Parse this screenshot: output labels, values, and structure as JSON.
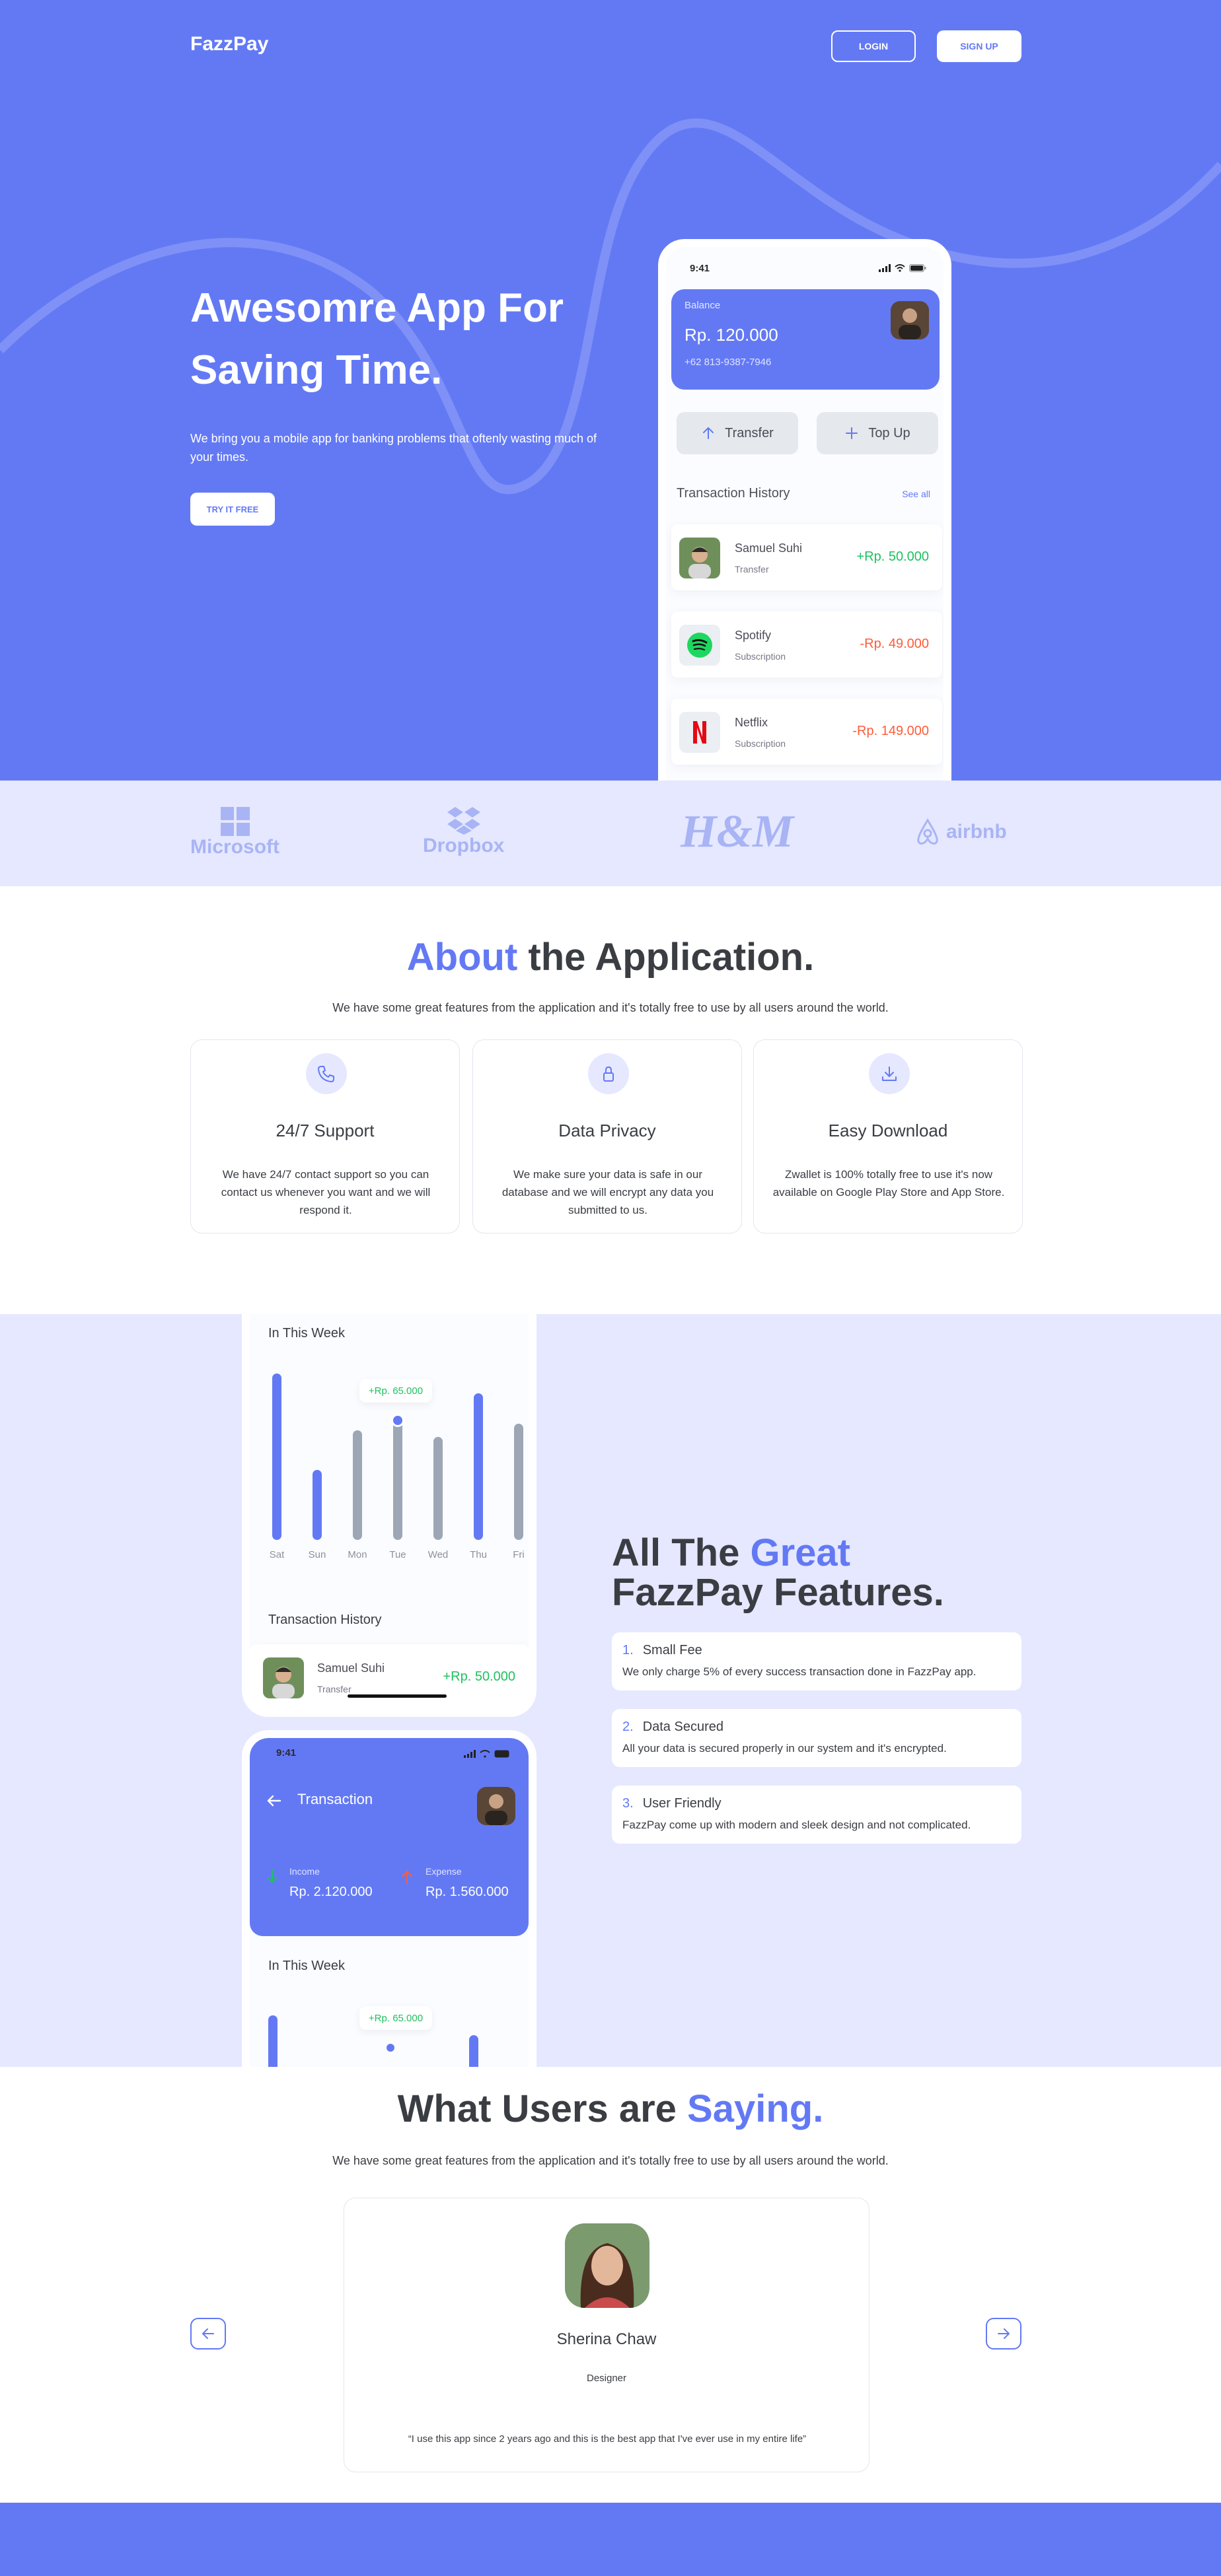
{
  "header": {
    "brand": "FazzPay",
    "login_label": "LOGIN",
    "signup_label": "SIGN UP"
  },
  "hero": {
    "title_line1": "Awesomre App For",
    "title_line2": "Saving Time.",
    "subtitle": "We bring you a mobile app for banking problems that oftenly wasting much of your times.",
    "cta_label": "TRY IT FREE"
  },
  "phone_home": {
    "time": "9:41",
    "balance_label": "Balance",
    "balance_amount": "Rp. 120.000",
    "phone_number": "+62 813-9387-7946",
    "transfer_label": "Transfer",
    "topup_label": "Top Up",
    "history_title": "Transaction History",
    "see_all": "See all",
    "transactions": [
      {
        "name": "Samuel Suhi",
        "type": "Transfer",
        "amount": "+Rp. 50.000"
      },
      {
        "name": "Spotify",
        "type": "Subscription",
        "amount": "-Rp. 49.000"
      },
      {
        "name": "Netflix",
        "type": "Subscription",
        "amount": "-Rp. 149.000"
      }
    ]
  },
  "partners": [
    "Microsoft",
    "Dropbox",
    "H&M",
    "airbnb"
  ],
  "about": {
    "title_accent": "About",
    "title_rest": " the Application.",
    "subtitle": "We have some great features from the application and it's totally free to use by all users around the world.",
    "cards": [
      {
        "title": "24/7 Support",
        "text": "We have 24/7 contact support so you can contact us whenever you want and we will respond it.",
        "icon": "phone-icon"
      },
      {
        "title": "Data Privacy",
        "text": "We make sure your data is safe in our database and we will encrypt any data you submitted to us.",
        "icon": "lock-icon"
      },
      {
        "title": "Easy Download",
        "text": "Zwallet is 100% totally free to use it's now available on Google Play Store and App Store.",
        "icon": "download-icon"
      }
    ]
  },
  "phone_chart": {
    "week_title": "In This Week",
    "tooltip": "+Rp. 65.000",
    "history_title": "Transaction History",
    "tx_name": "Samuel Suhi",
    "tx_type": "Transfer",
    "tx_amount": "+Rp. 50.000"
  },
  "chart_data": {
    "type": "bar",
    "categories": [
      "Sat",
      "Sun",
      "Mon",
      "Tue",
      "Wed",
      "Thu",
      "Fri"
    ],
    "values": [
      100,
      42,
      66,
      72,
      62,
      88,
      70
    ],
    "highlight": [
      true,
      true,
      false,
      false,
      false,
      true,
      false
    ],
    "selected": "Tue",
    "colors": {
      "highlight": "#6379f4",
      "normal": "#9da6b5"
    }
  },
  "phone_trx": {
    "time": "9:41",
    "title": "Transaction",
    "income_label": "Income",
    "income_amount": "Rp. 2.120.000",
    "expense_label": "Expense",
    "expense_amount": "Rp. 1.560.000",
    "week_title": "In This Week",
    "tooltip": "+Rp. 65.000"
  },
  "features": {
    "title_prefix": "All The ",
    "title_accent": "Great",
    "title_line2": "FazzPay Features.",
    "items": [
      {
        "num": "1.",
        "title": "Small Fee",
        "text": "We only charge 5% of every success transaction done in FazzPay app."
      },
      {
        "num": "2.",
        "title": "Data Secured",
        "text": "All your data is secured properly in our system and it's encrypted."
      },
      {
        "num": "3.",
        "title": "User Friendly",
        "text": "FazzPay come up with modern and sleek design and not complicated."
      }
    ]
  },
  "testimonials": {
    "title_prefix": "What Users are ",
    "title_accent": "Saying.",
    "subtitle": "We have some great features from the application and it's totally free to use by all users around the world.",
    "name": "Sherina Chaw",
    "role": "Designer",
    "quote": "“I use this app since 2 years ago and this is the best app that I've ever use in my entire life”"
  },
  "colors": {
    "primary": "#6379f4",
    "positive": "#1ec15f",
    "negative": "#ff5b37",
    "light_bg": "#e5e8ff"
  }
}
